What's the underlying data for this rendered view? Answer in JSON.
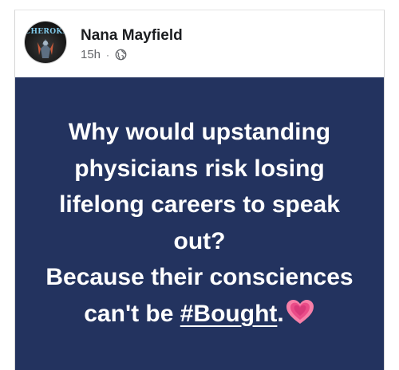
{
  "post": {
    "author": {
      "name": "Nana Mayfield",
      "avatar_text": "CHEROKEE"
    },
    "time": "15h",
    "separator": "·",
    "privacy_icon": "globe-icon",
    "body": {
      "lines": [
        "Why would upstanding",
        "physicians risk losing",
        "lifelong careers to speak",
        "out?",
        "Because their consciences"
      ],
      "last_line_prefix": "can't be ",
      "hashtag": "#Bought",
      "last_line_suffix": ".",
      "emoji_icon": "growing-heart-icon"
    },
    "background_color": "#23335f",
    "text_color": "#ffffff"
  }
}
